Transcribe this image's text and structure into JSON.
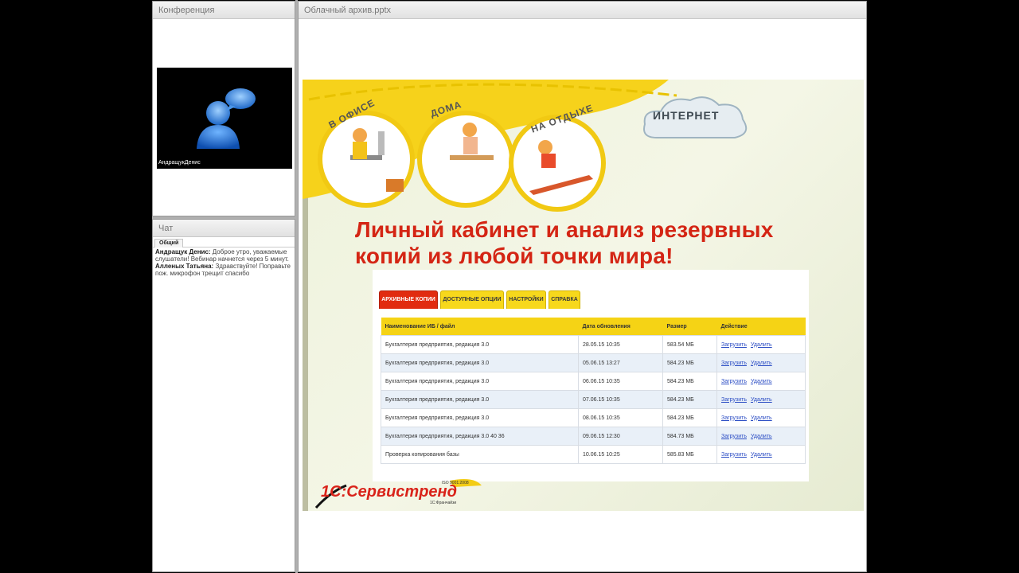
{
  "panels": {
    "conference_title": "Конференция",
    "chat_title": "Чат",
    "document_title": "Облачный архив.pptx"
  },
  "video": {
    "participant_name": "АндращукДенис"
  },
  "chat": {
    "tab": "Общий",
    "messages": [
      {
        "author": "Андращук Денис:",
        "text": " Доброе утро, уважаемые слушатели! Вебинар начнется через 5 минут."
      },
      {
        "author": "Алленых Татьяна:",
        "text": " Здравствуйте! Поправьте пож. микрофон трещит спасибо"
      }
    ]
  },
  "slide": {
    "banner": {
      "office": "В ОФИСЕ",
      "home": "ДОМА",
      "vacation": "НА ОТДЫХЕ",
      "internet": "ИНТЕРНЕТ"
    },
    "title_line1": "Личный кабинет и анализ резервных",
    "title_line2": "копий из любой точки мира!",
    "tabs": [
      "АРХИВНЫЕ КОПИИ",
      "ДОСТУПНЫЕ ОПЦИИ",
      "НАСТРОЙКИ",
      "СПРАВКА"
    ],
    "table": {
      "headers": [
        "Наименование ИБ / файл",
        "Дата обновления",
        "Размер",
        "Действие"
      ],
      "action_labels": {
        "load": "Загрузить",
        "delete": "Удалить"
      },
      "rows": [
        {
          "name": "Бухгалтерия предприятия, редакция 3.0",
          "date": "28.05.15 10:35",
          "size": "583.54 МБ"
        },
        {
          "name": "Бухгалтерия предприятия, редакция 3.0",
          "date": "05.06.15 13:27",
          "size": "584.23 МБ"
        },
        {
          "name": "Бухгалтерия предприятия, редакция 3.0",
          "date": "06.06.15 10:35",
          "size": "584.23 МБ"
        },
        {
          "name": "Бухгалтерия предприятия, редакция 3.0",
          "date": "07.06.15 10:35",
          "size": "584.23 МБ"
        },
        {
          "name": "Бухгалтерия предприятия, редакция 3.0",
          "date": "08.06.15 10:35",
          "size": "584.23 МБ"
        },
        {
          "name": "Бухгалтерия предприятия, редакция 3.0 40 36",
          "date": "09.06.15 12:30",
          "size": "584.73 МБ"
        },
        {
          "name": "Проверка копирования базы",
          "date": "10.06.15 10:25",
          "size": "585.83 МБ"
        }
      ]
    },
    "logo": {
      "brand": "1С:Сервистренд",
      "iso": "ISO 9001:2008",
      "franchise": "1С:Франчайзи"
    }
  }
}
